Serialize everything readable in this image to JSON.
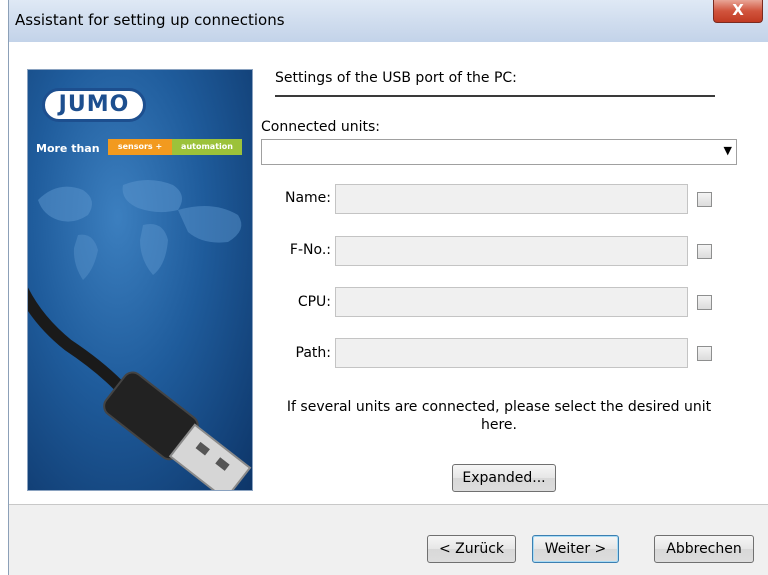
{
  "window": {
    "title": "Assistant for setting up connections",
    "close_label": "X"
  },
  "banner": {
    "logo": "JUMO",
    "tagline_prefix": "More than",
    "tag_sensors": "sensors",
    "tag_plus": "+",
    "tag_automation": "automation",
    "colors": {
      "blue": "#1f5c9c",
      "orange": "#f29a1f",
      "green": "#9cc23a"
    }
  },
  "section": {
    "title": "Settings of the USB port of the PC:"
  },
  "connected_units": {
    "label": "Connected units:",
    "value": ""
  },
  "fields": [
    {
      "label": "Name:",
      "value": "",
      "checked": false
    },
    {
      "label": "F-No.:",
      "value": "",
      "checked": false
    },
    {
      "label": "CPU:",
      "value": "",
      "checked": false
    },
    {
      "label": "Path:",
      "value": "",
      "checked": false
    }
  ],
  "hint": "If several units are connected, please select the desired unit here.",
  "expanded_button": "Expanded...",
  "footer": {
    "back": "< Zurück",
    "next": "Weiter >",
    "cancel": "Abbrechen"
  }
}
